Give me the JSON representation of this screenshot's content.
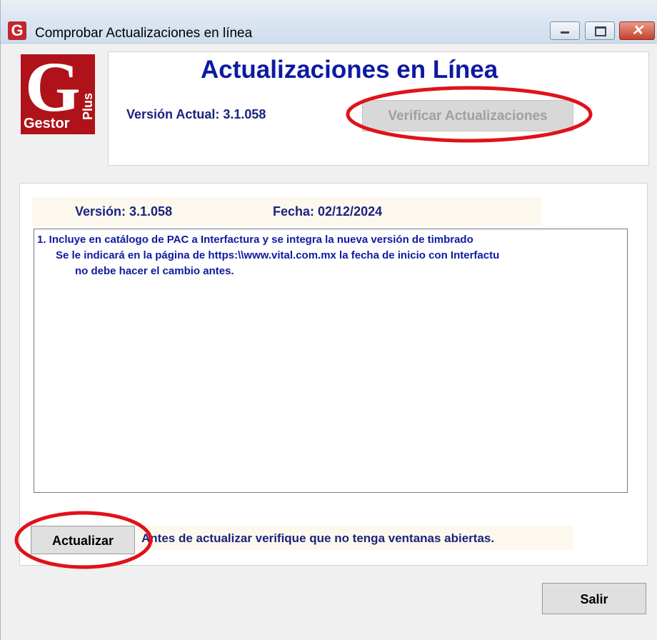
{
  "window": {
    "title": "Comprobar Actualizaciones en línea",
    "icon": "G"
  },
  "logo": {
    "letter": "G",
    "name": "Gestor",
    "suffix": "Plus"
  },
  "header": {
    "title": "Actualizaciones en Línea",
    "current_version": "Versión Actual: 3.1.058",
    "verify_button": "Verificar Actualizaciones",
    "verify_enabled": false
  },
  "release": {
    "version": "Versión: 3.1.058",
    "date": "Fecha: 02/12/2024",
    "notes": [
      "1. Incluye en catálogo de PAC a Interfactura y se integra la nueva versión de timbrado",
      "Se le indicará en la página de https:\\\\www.vital.com.mx la fecha de inicio con Interfactu",
      "no debe hacer el cambio antes."
    ]
  },
  "footer": {
    "update_button": "Actualizar",
    "warning": "Antes de actualizar verifique que no tenga ventanas abiertas.",
    "exit_button": "Salir"
  },
  "colors": {
    "accent_text": "#0d1aa0",
    "annotation": "#e0121a",
    "logo_red": "#b0121a"
  }
}
